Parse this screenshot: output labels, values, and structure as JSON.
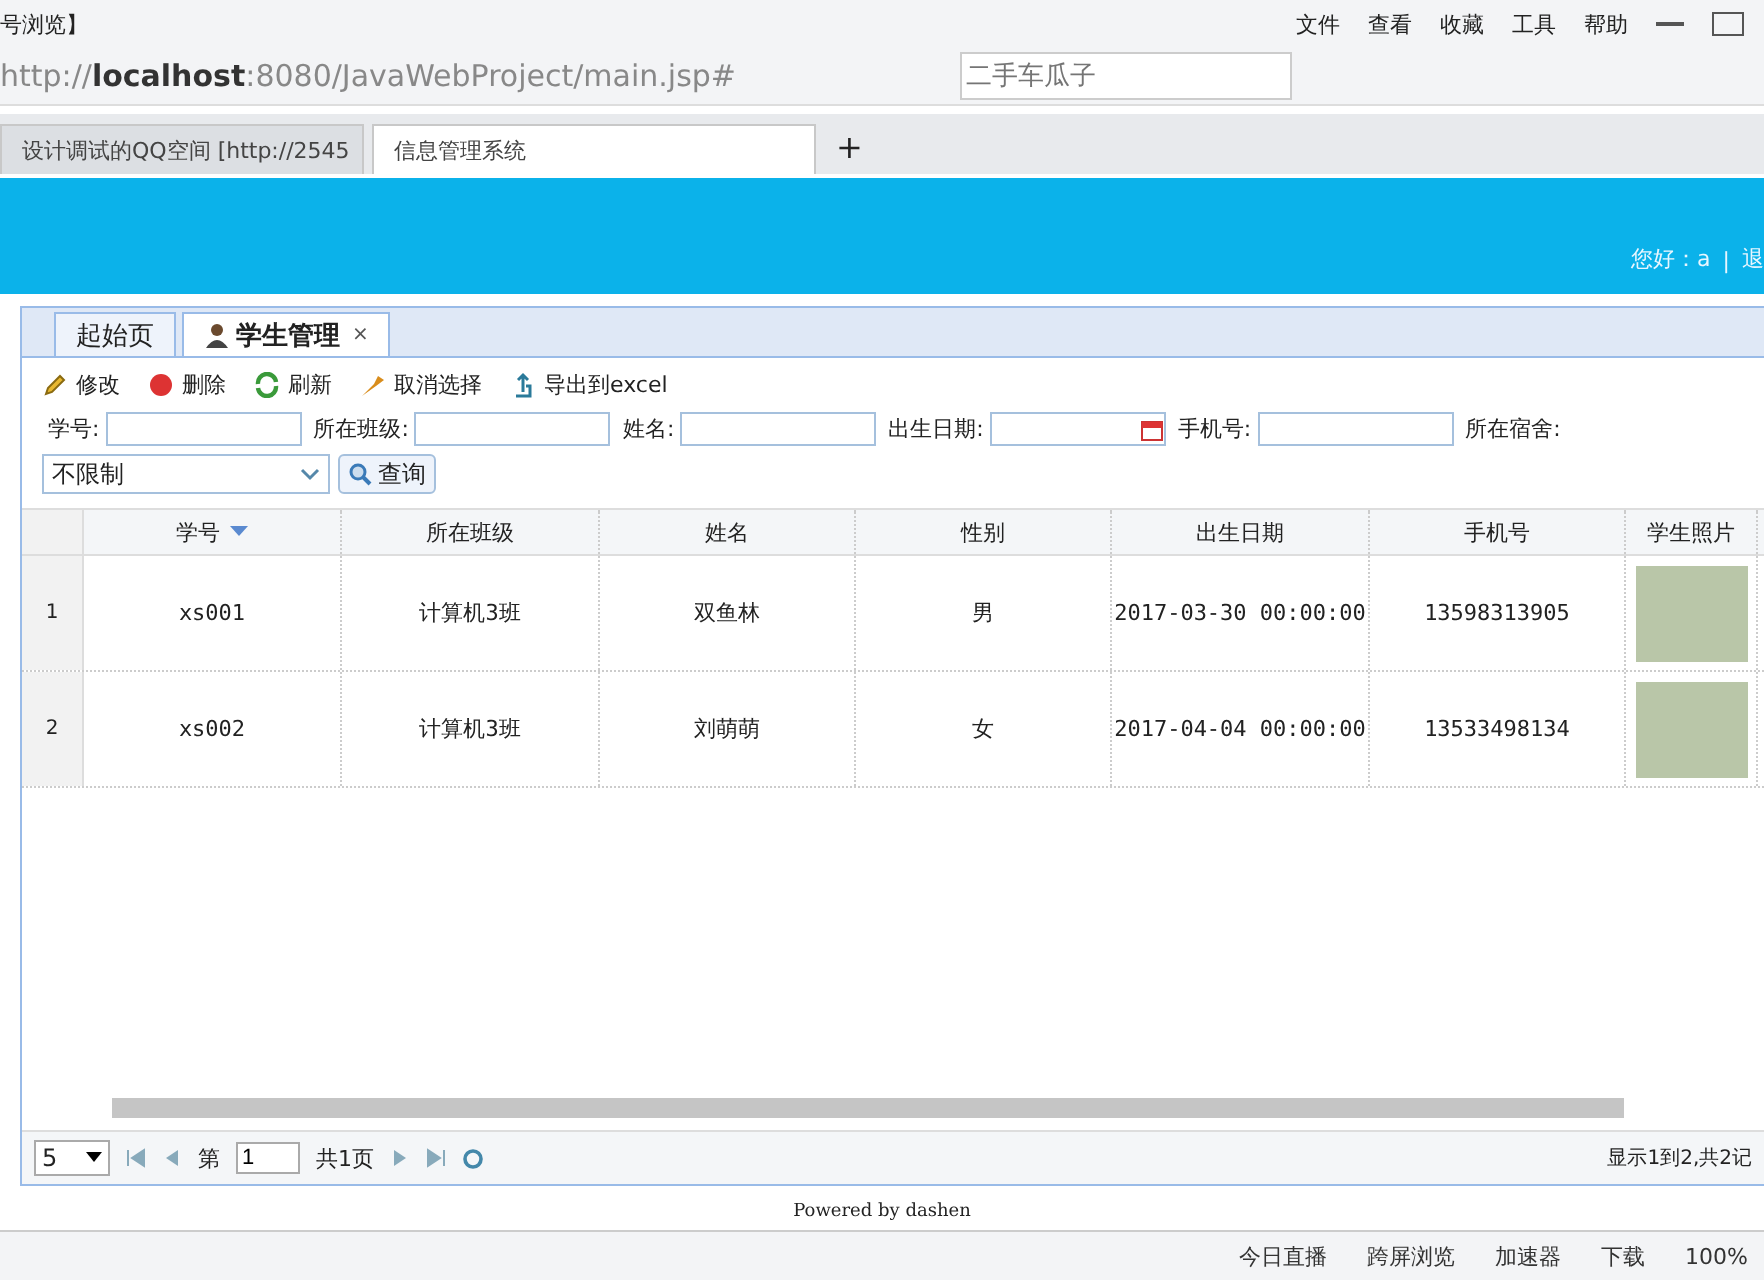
{
  "browser": {
    "title": "号浏览】",
    "menu": [
      "文件",
      "查看",
      "收藏",
      "工具",
      "帮助"
    ],
    "url_host": "localhost",
    "url_scheme": "http://",
    "url_rest": ":8080/JavaWebProject/main.jsp#",
    "search": {
      "placeholder": "二手车瓜子"
    },
    "tabs": [
      {
        "label": "设计调试的QQ空间 [http://2545",
        "selected": false
      },
      {
        "label": "信息管理系统",
        "selected": true
      }
    ],
    "new_tab": "+"
  },
  "header": {
    "greeting": "您好：a",
    "separator": "|",
    "logout": "退"
  },
  "panel_tabs": [
    {
      "label": "起始页",
      "selected": false
    },
    {
      "label": "学生管理",
      "selected": true,
      "close": "×"
    }
  ],
  "toolbar": [
    {
      "label": "修改",
      "kind": "edit"
    },
    {
      "label": "删除",
      "kind": "delete"
    },
    {
      "label": "刷新",
      "kind": "refresh"
    },
    {
      "label": "取消选择",
      "kind": "cancel"
    },
    {
      "label": "导出到excel",
      "kind": "export"
    }
  ],
  "filters": [
    {
      "label": "学号:",
      "kind": "text"
    },
    {
      "label": "所在班级:",
      "kind": "text"
    },
    {
      "label": "姓名:",
      "kind": "text"
    },
    {
      "label": "出生日期:",
      "kind": "date"
    },
    {
      "label": "手机号:",
      "kind": "text"
    },
    {
      "label": "所在宿舍:",
      "kind": "none"
    }
  ],
  "dorm_select": "不限制",
  "query_button": "查询",
  "table": {
    "columns": [
      {
        "label": "学号",
        "sorted": true
      },
      {
        "label": "所在班级",
        "sorted": false
      },
      {
        "label": "姓名",
        "sorted": false
      },
      {
        "label": "性别",
        "sorted": false
      },
      {
        "label": "出生日期",
        "sorted": false
      },
      {
        "label": "手机号",
        "sorted": false
      },
      {
        "label": "学生照片",
        "sorted": false
      }
    ],
    "rows": [
      {
        "index": "1",
        "cells": [
          "xs001",
          "计算机3班",
          "双鱼林",
          "男",
          "2017-03-30 00:00:00",
          "13598313905"
        ]
      },
      {
        "index": "2",
        "cells": [
          "xs002",
          "计算机3班",
          "刘萌萌",
          "女",
          "2017-04-04 00:00:00",
          "13533498134"
        ]
      }
    ]
  },
  "pager": {
    "page_size": "5",
    "page_prefix": "第",
    "page": "1",
    "page_suffix": "共1页",
    "summary": "显示1到2,共2记"
  },
  "footer": "Powered by dashen",
  "status_bar": [
    "今日直播",
    "跨屏浏览",
    "加速器",
    "下载",
    "100%"
  ]
}
